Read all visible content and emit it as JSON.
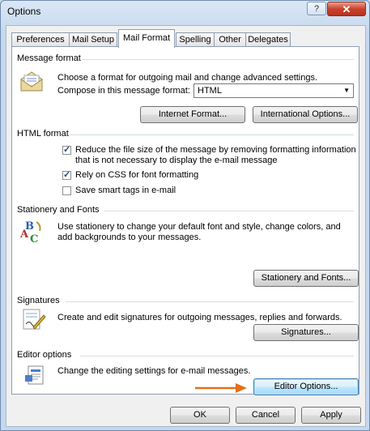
{
  "window": {
    "title": "Options",
    "help_glyph": "?",
    "close_glyph": "✕"
  },
  "tabs": [
    {
      "label": "Preferences"
    },
    {
      "label": "Mail Setup"
    },
    {
      "label": "Mail Format"
    },
    {
      "label": "Spelling"
    },
    {
      "label": "Other"
    },
    {
      "label": "Delegates"
    }
  ],
  "message_format": {
    "header": "Message format",
    "description": "Choose a format for outgoing mail and change advanced settings.",
    "compose_label": "Compose in this message format:",
    "compose_value": "HTML",
    "internet_format_button": "Internet Format...",
    "international_options_button": "International Options..."
  },
  "html_format": {
    "header": "HTML format",
    "reduce_size_line1": "Reduce the file size of the message by removing formatting information",
    "reduce_size_line2": "that is not necessary to display the e-mail message",
    "reduce_size_checked": true,
    "rely_css": "Rely on CSS for font formatting",
    "rely_css_checked": true,
    "smart_tags": "Save smart tags in e-mail",
    "smart_tags_checked": false
  },
  "stationery": {
    "header": "Stationery and Fonts",
    "description_line1": "Use stationery to change your default font and style, change colors, and",
    "description_line2": "add backgrounds to your messages.",
    "button": "Stationery and Fonts..."
  },
  "signatures": {
    "header": "Signatures",
    "description": "Create and edit signatures for outgoing messages, replies and forwards.",
    "button": "Signatures..."
  },
  "editor": {
    "header": "Editor options",
    "description": "Change the editing settings for e-mail messages.",
    "button": "Editor Options..."
  },
  "footer": {
    "ok": "OK",
    "cancel": "Cancel",
    "apply": "Apply"
  },
  "colors": {
    "arrow": "#e0701a",
    "focus_border": "#3c7fb1"
  }
}
